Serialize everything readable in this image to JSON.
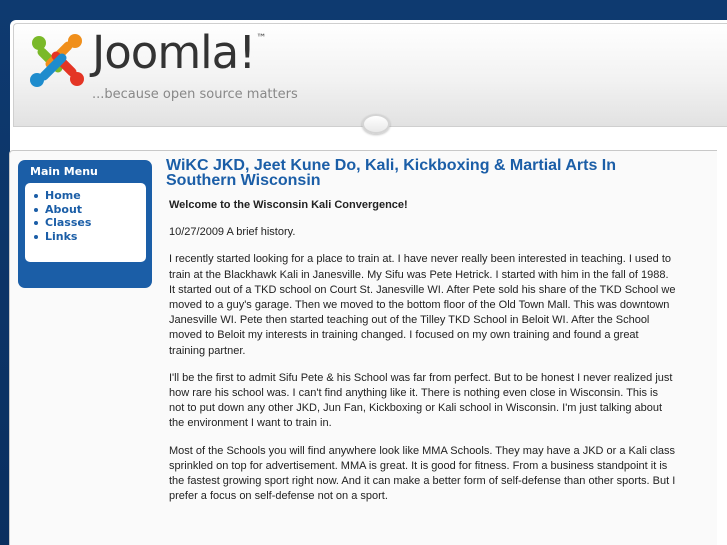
{
  "header": {
    "logo_word": "Joomla!",
    "logo_tagline": "...because open source matters",
    "brand_colors": {
      "green": "#7ab929",
      "orange": "#f08f1b",
      "red": "#e43525",
      "blue": "#1e8ccd"
    }
  },
  "main_menu": {
    "title": "Main Menu",
    "items": [
      {
        "label": "Home"
      },
      {
        "label": "About"
      },
      {
        "label": "Classes"
      },
      {
        "label": "Links"
      }
    ]
  },
  "article": {
    "title": "WiKC JKD, Jeet Kune Do, Kali, Kickboxing & Martial Arts In Southern Wisconsin",
    "welcome": "Welcome to the Wisconsin Kali Convergence!",
    "date_line": "10/27/2009 A brief history.",
    "paragraphs": [
      "I recently started looking for a place to train at.  I have never really been interested in teaching.  I used to train at the Blackhawk Kali in Janesville.  My Sifu was Pete Hetrick.  I started with him in the fall of 1988.  It started out of a TKD school on Court St. Janesville WI. After Pete sold his share of the TKD School we moved to a guy's garage.  Then we moved to the bottom floor of the Old Town Mall.  This was downtown Janesville WI. Pete then started teaching out of the Tilley TKD School in Beloit WI. After the School moved to Beloit my interests in training changed.  I focused on my own training and found a great training partner.",
      "I'll be the first to admit Sifu Pete & his School was far from perfect.  But to be honest I never realized just how rare his school was. I can't find anything like it.  There is nothing even close in Wisconsin. This is not to put down any other JKD, Jun Fan, Kickboxing or Kali school in Wisconsin.  I'm just talking about the environment I want to train in.",
      "Most of the Schools you will find anywhere look like MMA Schools.  They may have a JKD or a Kali class sprinkled on top for advertisement. MMA is great. It is good for fitness.  From a business standpoint it is the fastest growing sport right now.  And it can make a better form of self-defense than other sports. But I prefer a focus on self-defense not on a sport."
    ]
  },
  "colors": {
    "background": "#0b3467",
    "accent_blue": "#1b5ea7"
  }
}
